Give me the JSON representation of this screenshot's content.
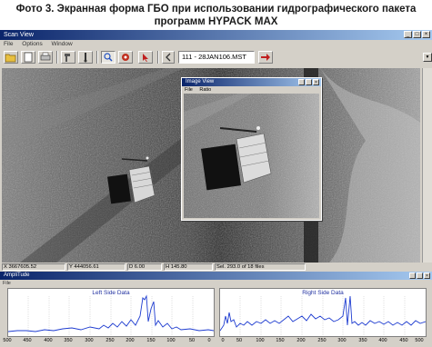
{
  "caption": {
    "line1": "Фото 3. Экранная форма ГБО при использовании гидрографического пакета",
    "line2": "программ HYPACK MAX"
  },
  "main_window": {
    "title": "Scan View",
    "menu": [
      "File",
      "Options",
      "Window"
    ],
    "file_selector": "111 - 28JAN106.MST",
    "toolbar_icons": [
      "open-folder-icon",
      "new-file-icon",
      "print-icon",
      "tool-icon",
      "marker-icon",
      "zoom-icon",
      "target-icon",
      "pointer-icon",
      "arrow-icon"
    ],
    "status": [
      "X 3667605.52",
      "Y 444056.61",
      "D 6.00",
      "H 145.80",
      "Sel. 293.0 of 18 files"
    ]
  },
  "image_view": {
    "title": "Image View",
    "menu": [
      "File",
      "Ratio"
    ]
  },
  "amplitude_window": {
    "title": "AmpliTude",
    "menu": [
      "File"
    ],
    "left_plot_title": "Left Side Data",
    "right_plot_title": "Right Side Data",
    "left_axis": [
      "500",
      "450",
      "400",
      "350",
      "300",
      "250",
      "200",
      "150",
      "100",
      "50",
      "0"
    ],
    "right_axis": [
      "0",
      "50",
      "100",
      "150",
      "200",
      "250",
      "300",
      "350",
      "400",
      "450",
      "500"
    ]
  },
  "colors": {
    "title_gradient_start": "#0a246a",
    "title_gradient_end": "#a6caf0",
    "plot_line": "#1e3cd0",
    "window_face": "#d4d0c8"
  }
}
